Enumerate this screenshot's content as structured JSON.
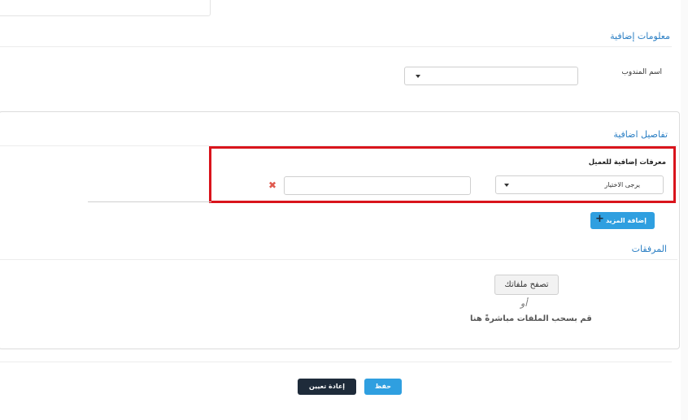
{
  "additional_info": {
    "title": "معلومات إضافية",
    "agent_label": "اسم المندوب",
    "agent_value": ""
  },
  "additional_details": {
    "title": "تفاصيل اضافية",
    "client_ids_label": "معرفات إضافية للعميل",
    "select_placeholder": "يرجى الاختيار",
    "value_input": "",
    "add_more_label": "إضافة المزيد"
  },
  "attachments": {
    "title": "المرفقات",
    "browse_label": "تصفح ملفاتك",
    "or_text": "أو",
    "drop_hint": "قم بسحب الملفات مباشرةً هنا"
  },
  "footer": {
    "save_label": "حفظ",
    "reset_label": "إعادة تعيين"
  },
  "colors": {
    "accent": "#2f9fe0",
    "dark": "#1e2b3a",
    "highlight": "#d9141c",
    "remove": "#e05a4f"
  }
}
